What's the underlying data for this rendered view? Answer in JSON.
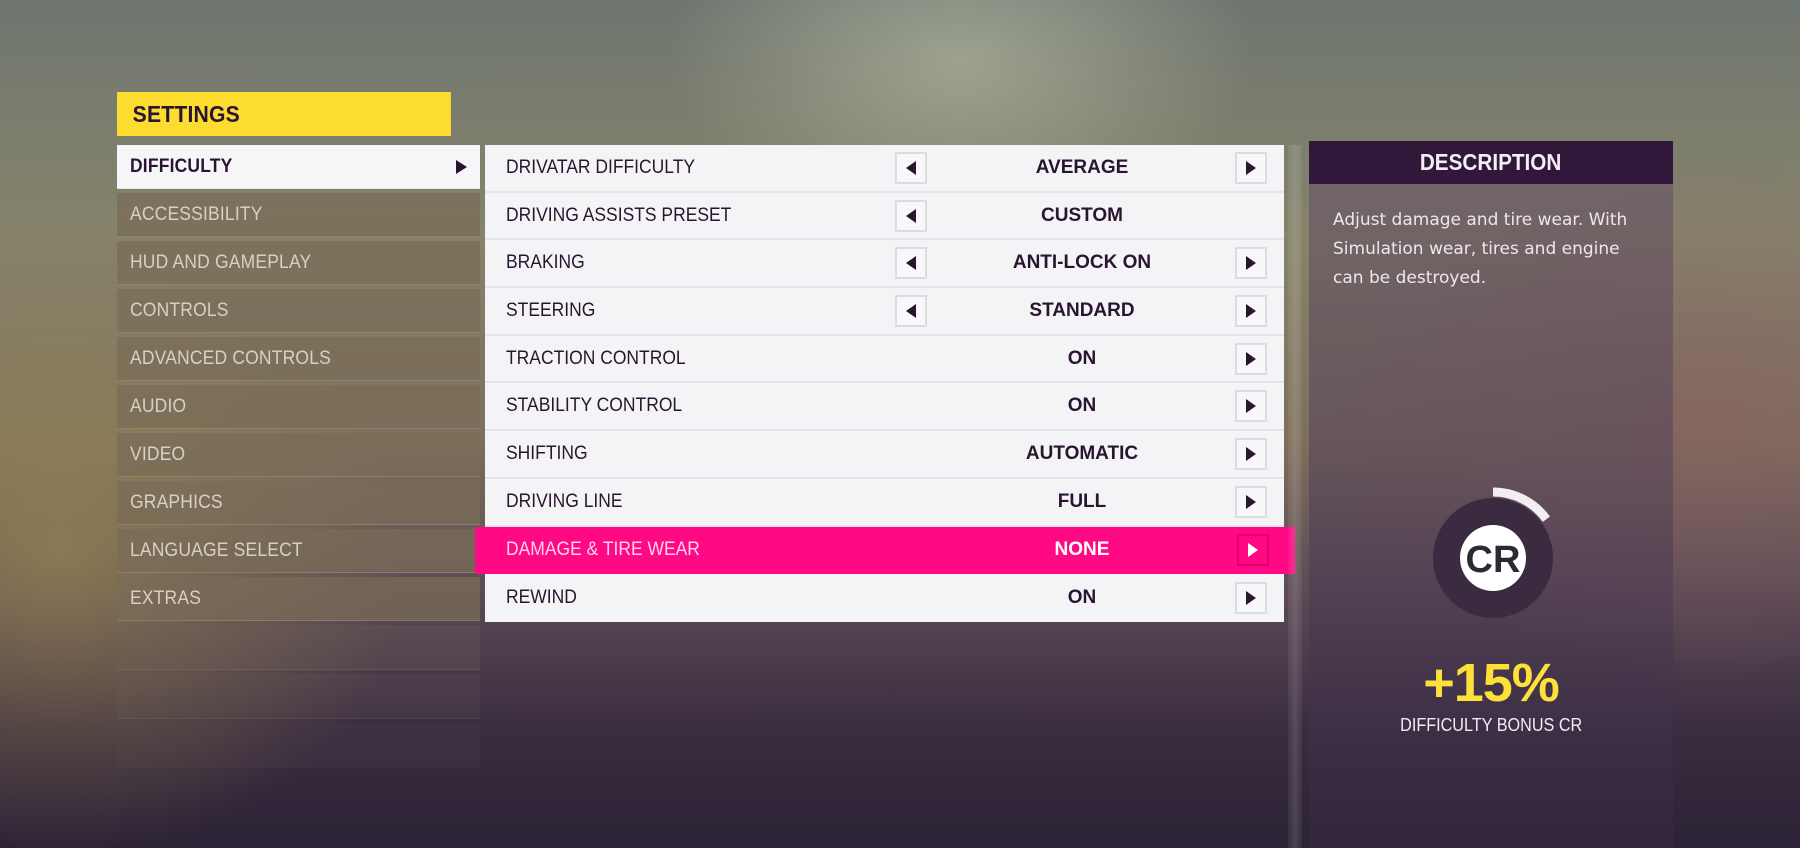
{
  "header": {
    "title": "SETTINGS"
  },
  "colors": {
    "accent_yellow": "#fcdc2e",
    "selected_pink": "#ff0a84",
    "dark_purple": "#31173a",
    "bonus_yellow": "#fde03a"
  },
  "nav": {
    "items": [
      {
        "label": "DIFFICULTY",
        "active": true
      },
      {
        "label": "ACCESSIBILITY"
      },
      {
        "label": "HUD AND GAMEPLAY"
      },
      {
        "label": "CONTROLS"
      },
      {
        "label": "ADVANCED CONTROLS"
      },
      {
        "label": "AUDIO"
      },
      {
        "label": "VIDEO"
      },
      {
        "label": "GRAPHICS"
      },
      {
        "label": "LANGUAGE SELECT"
      },
      {
        "label": "EXTRAS"
      }
    ]
  },
  "options": {
    "rows": [
      {
        "label": "DRIVATAR DIFFICULTY",
        "value": "AVERAGE",
        "left_arrow": true,
        "right_arrow": true
      },
      {
        "label": "DRIVING ASSISTS PRESET",
        "value": "CUSTOM",
        "left_arrow": true,
        "right_arrow": false
      },
      {
        "label": "BRAKING",
        "value": "ANTI-LOCK ON",
        "left_arrow": true,
        "right_arrow": true
      },
      {
        "label": "STEERING",
        "value": "STANDARD",
        "left_arrow": true,
        "right_arrow": true
      },
      {
        "label": "TRACTION CONTROL",
        "value": "ON",
        "left_arrow": false,
        "right_arrow": true
      },
      {
        "label": "STABILITY CONTROL",
        "value": "ON",
        "left_arrow": false,
        "right_arrow": true
      },
      {
        "label": "SHIFTING",
        "value": "AUTOMATIC",
        "left_arrow": false,
        "right_arrow": true
      },
      {
        "label": "DRIVING LINE",
        "value": "FULL",
        "left_arrow": false,
        "right_arrow": true
      },
      {
        "label": "DAMAGE & TIRE WEAR",
        "value": "NONE",
        "left_arrow": false,
        "right_arrow": true,
        "selected": true
      },
      {
        "label": "REWIND",
        "value": "ON",
        "left_arrow": false,
        "right_arrow": true
      }
    ]
  },
  "description": {
    "title": "DESCRIPTION",
    "text": "Adjust damage and tire wear. With Simulation wear, tires and engine can be destroyed.",
    "gauge": {
      "icon_label": "CR",
      "fill_fraction": 0.15
    },
    "bonus_value": "+15%",
    "bonus_label": "DIFFICULTY BONUS CR"
  }
}
